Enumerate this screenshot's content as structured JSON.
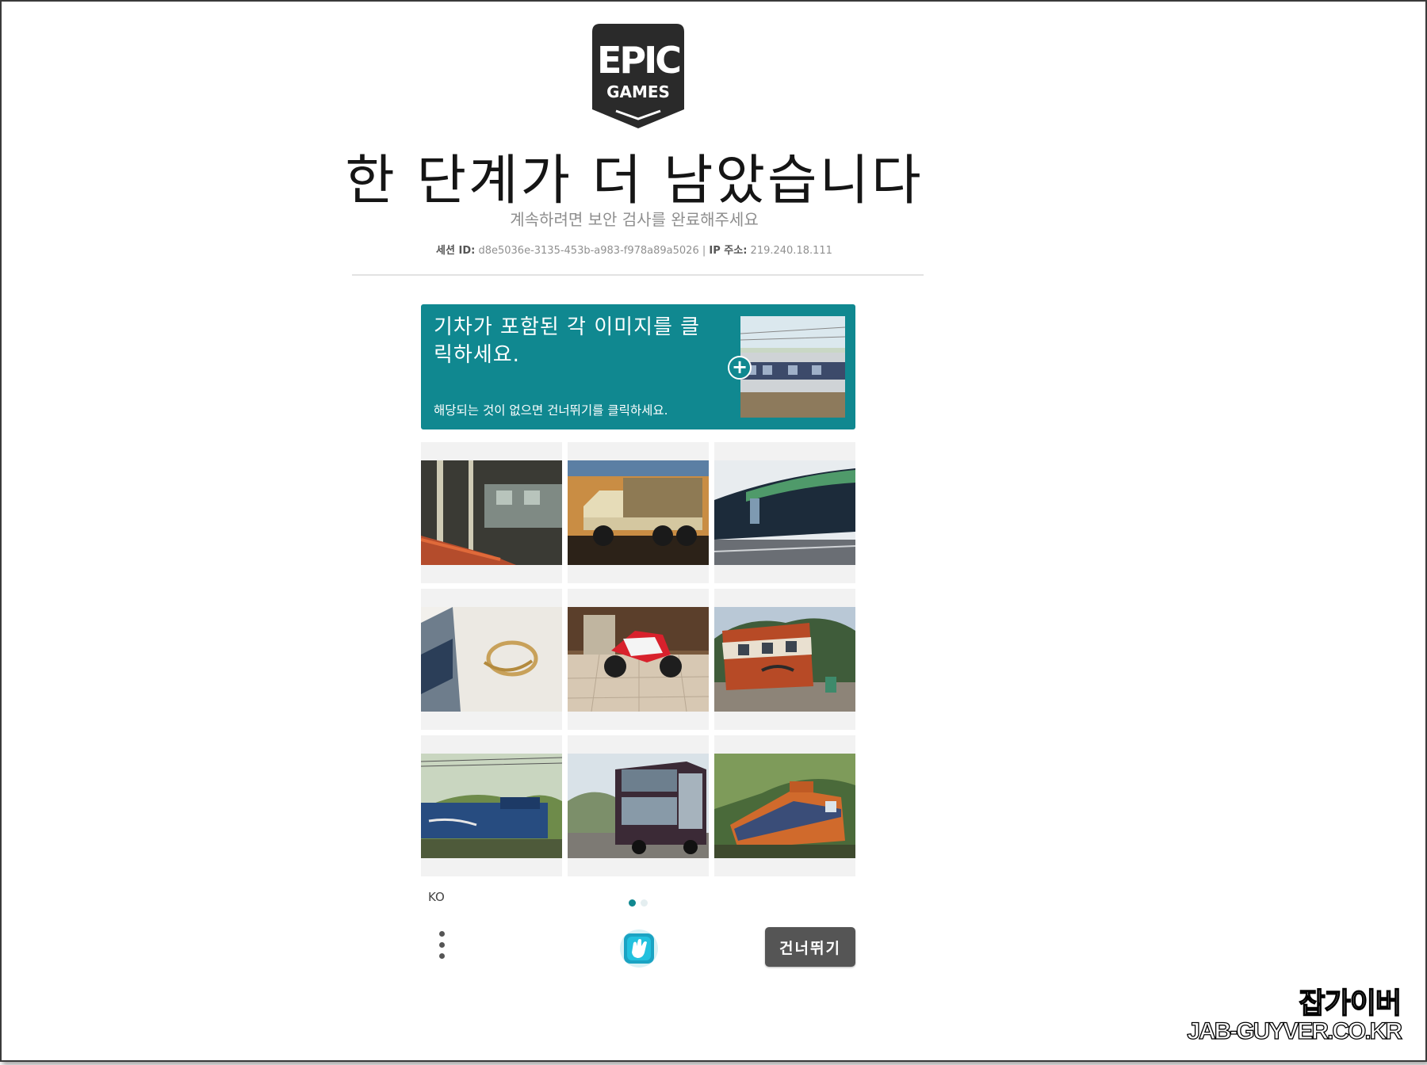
{
  "header": {
    "logo_line1": "EPIC",
    "logo_line2": "GAMES",
    "title": "한 단계가 더 남았습니다",
    "subtitle": "계속하려면 보안 검사를 완료해주세요",
    "session_label": "세션 ID:",
    "session_id": "d8e5036e-3135-453b-a983-f978a89a5026",
    "separator": "|",
    "ip_label": "IP 주소:",
    "ip_value": "219.240.18.111"
  },
  "challenge": {
    "prompt": "기차가 포함된 각 이미지를 클릭하세요.",
    "hint": "해당되는 것이 없으면 건너뛰기를 클릭하세요.",
    "sample_icon": "plus-icon",
    "background_color": "#108890"
  },
  "grid": {
    "tiles": [
      {
        "icon": "subway-station-photo"
      },
      {
        "icon": "truck-photo"
      },
      {
        "icon": "train-side-photo"
      },
      {
        "icon": "white-train-photo"
      },
      {
        "icon": "motorcycle-photo"
      },
      {
        "icon": "bus-photo"
      },
      {
        "icon": "blue-locomotive-photo"
      },
      {
        "icon": "double-decker-bus-photo"
      },
      {
        "icon": "orange-locomotive-photo"
      }
    ]
  },
  "footer": {
    "language": "KO",
    "page_count": 2,
    "current_page": 1,
    "skip_label": "건너뛰기",
    "menu_icon": "kebab-menu-icon",
    "brand_icon": "hcaptcha-icon"
  },
  "watermark": {
    "title": "잡가이버",
    "url": "JAB-GUYVER.CO.KR"
  }
}
